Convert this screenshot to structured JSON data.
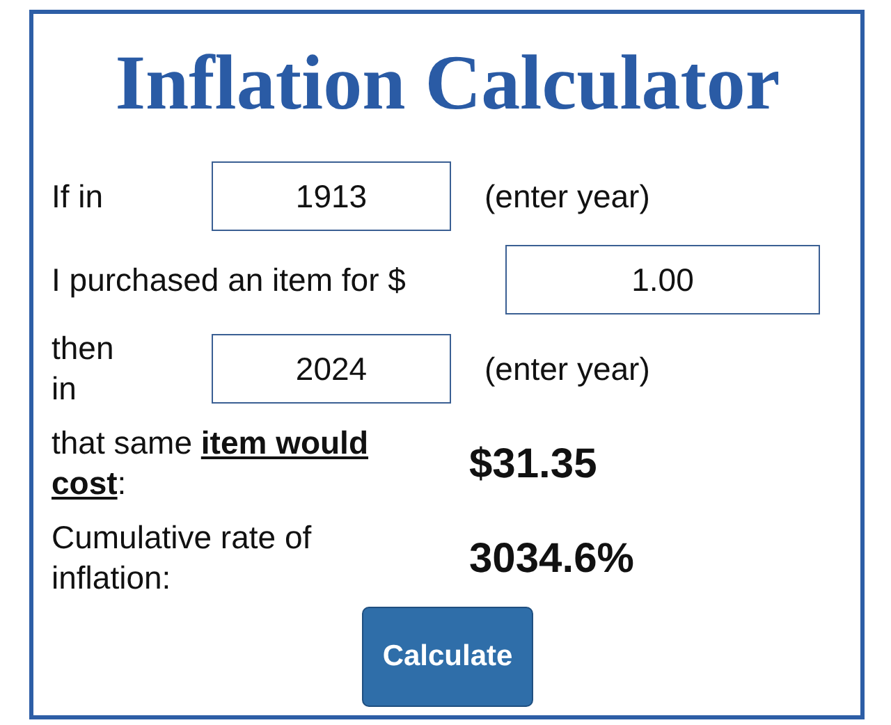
{
  "title": "Inflation Calculator",
  "rows": [
    {
      "kind": "year",
      "label": "If in",
      "value": "1913",
      "hint": "(enter year)"
    },
    {
      "kind": "amount",
      "label": "I purchased an item for $",
      "value": "1.00"
    },
    {
      "kind": "year",
      "label": "then in",
      "value": "2024",
      "hint": "(enter year)"
    },
    {
      "kind": "result",
      "label": "that same **item would cost**:",
      "value": "$31.35"
    },
    {
      "kind": "result",
      "label": "Cumulative rate of inflation:",
      "value": "3034.6%"
    }
  ],
  "button": "Calculate"
}
